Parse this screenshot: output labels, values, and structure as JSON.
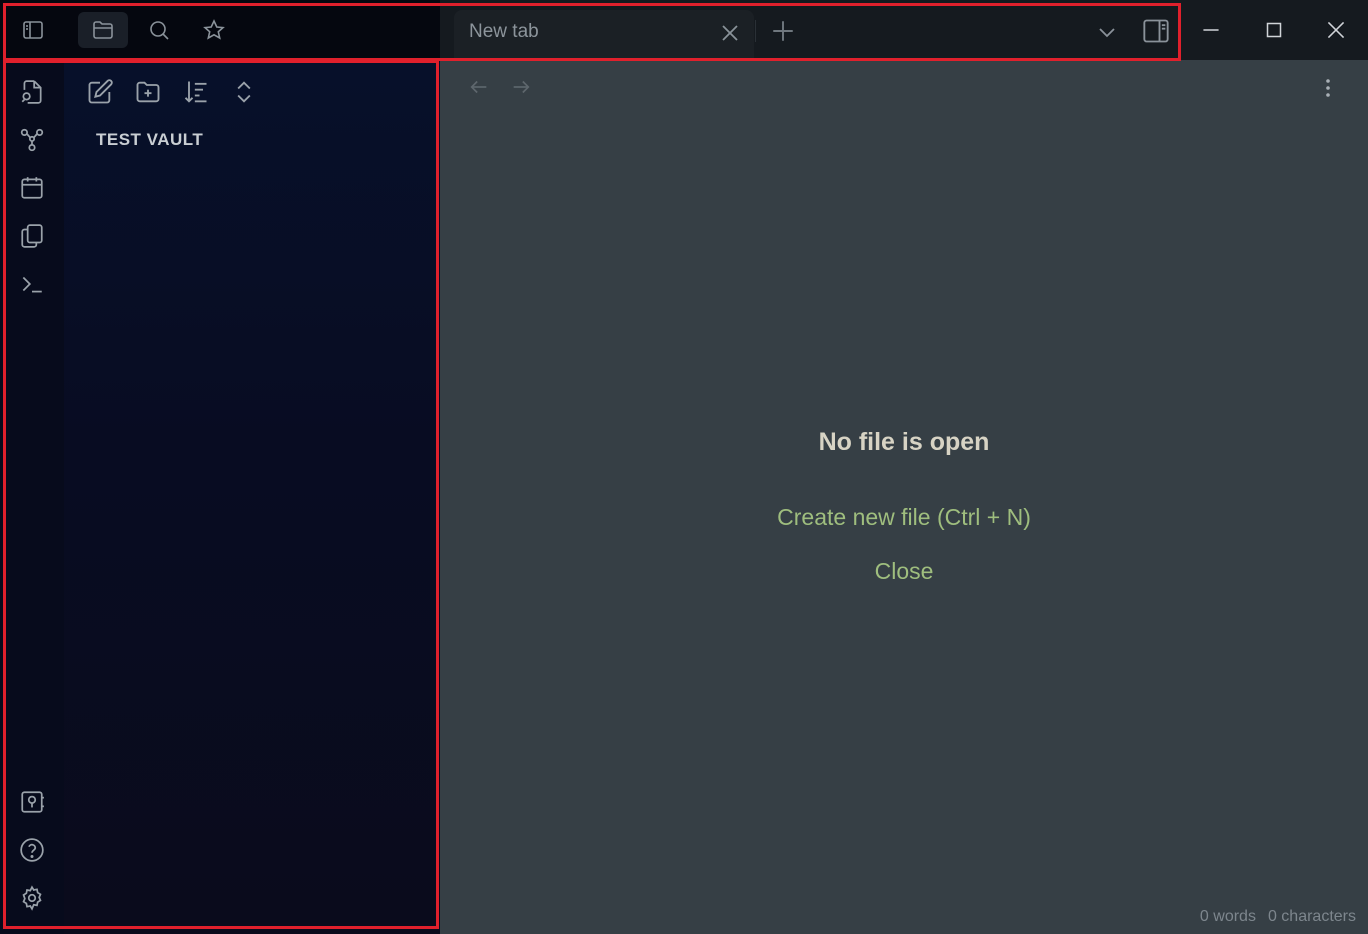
{
  "titlebar": {
    "left_buttons": [
      {
        "icon": "sidebar-toggle-icon"
      },
      {
        "icon": "folder-icon",
        "active": true
      },
      {
        "icon": "search-icon"
      },
      {
        "icon": "star-icon"
      }
    ],
    "tab": {
      "title": "New tab"
    },
    "window_controls": [
      "minimize-icon",
      "maximize-icon",
      "close-icon"
    ]
  },
  "ribbon": {
    "top_icons": [
      "open-quick-switcher-icon",
      "graph-view-icon",
      "calendar-icon",
      "templates-icon",
      "terminal-icon"
    ],
    "bottom_icons": [
      "vault-switcher-icon",
      "help-icon",
      "settings-icon"
    ]
  },
  "explorer": {
    "toolbar_icons": [
      "new-note-icon",
      "new-folder-icon",
      "sort-icon",
      "collapse-expand-icon"
    ],
    "vault_name": "TEST VAULT"
  },
  "main": {
    "empty_title": "No file is open",
    "create_action": "Create new file (Ctrl + N)",
    "close_action": "Close"
  },
  "status_bar": {
    "words": "0 words",
    "characters": "0 characters"
  },
  "colors": {
    "accent_link": "#9fbe7e",
    "highlight_border": "#e0202c"
  }
}
